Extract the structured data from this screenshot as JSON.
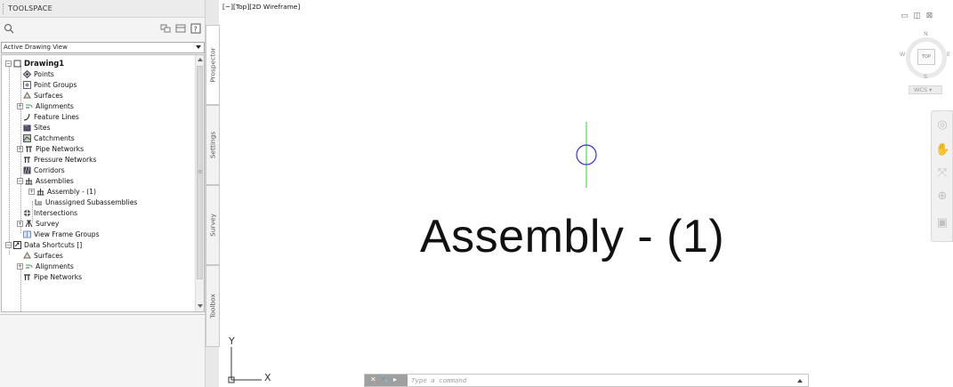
{
  "toolspace": {
    "title": "TOOLSPACE",
    "view_select": "Active Drawing View",
    "tree": [
      {
        "label": "Drawing1",
        "icon": "drawing-icon",
        "bold": true,
        "expanded": true
      },
      {
        "label": "Points",
        "icon": "points-icon"
      },
      {
        "label": "Point Groups",
        "icon": "point-groups-icon"
      },
      {
        "label": "Surfaces",
        "icon": "surfaces-icon"
      },
      {
        "label": "Alignments",
        "icon": "alignments-icon",
        "expandable": true
      },
      {
        "label": "Feature Lines",
        "icon": "feature-lines-icon"
      },
      {
        "label": "Sites",
        "icon": "sites-icon"
      },
      {
        "label": "Catchments",
        "icon": "catchments-icon"
      },
      {
        "label": "Pipe Networks",
        "icon": "pipe-networks-icon",
        "expandable": true
      },
      {
        "label": "Pressure Networks",
        "icon": "pressure-networks-icon"
      },
      {
        "label": "Corridors",
        "icon": "corridors-icon"
      },
      {
        "label": "Assemblies",
        "icon": "assemblies-icon",
        "expanded": true
      },
      {
        "label": "Assembly - (1)",
        "icon": "assembly-icon",
        "expandable": true
      },
      {
        "label": "Unassigned Subassemblies",
        "icon": "subassemblies-icon"
      },
      {
        "label": "Intersections",
        "icon": "intersections-icon"
      },
      {
        "label": "Survey",
        "icon": "survey-icon",
        "expandable": true
      },
      {
        "label": "View Frame Groups",
        "icon": "view-frame-groups-icon"
      },
      {
        "label": "Data Shortcuts []",
        "icon": "data-shortcuts-icon",
        "expanded": true
      },
      {
        "label": "Surfaces",
        "icon": "surfaces-icon"
      },
      {
        "label": "Alignments",
        "icon": "alignments-icon",
        "expandable": true
      },
      {
        "label": "Pipe Networks",
        "icon": "pipe-networks-icon"
      }
    ],
    "tabs": [
      "Prospector",
      "Settings",
      "Survey",
      "Toolbox"
    ],
    "active_tab": "Prospector"
  },
  "viewport": {
    "label": "[−][Top][2D Wireframe]",
    "assembly_label": "Assembly - (1)",
    "ucs_y": "Y",
    "ucs_x": "X"
  },
  "viewcube": {
    "north": "N",
    "south": "S",
    "east": "E",
    "west": "W",
    "face": "TOP",
    "wcs": "WCS"
  },
  "command": {
    "placeholder": "Type a command"
  },
  "colors": {
    "marker_circle": "#3333cc",
    "marker_line": "#33cc33",
    "panel_bg": "#f4f4f4"
  }
}
